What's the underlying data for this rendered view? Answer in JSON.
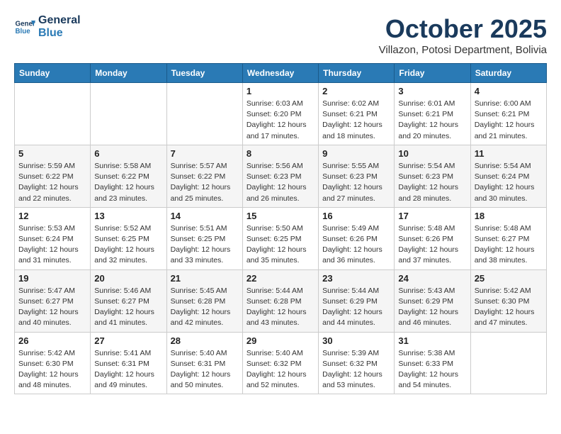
{
  "header": {
    "logo_line1": "General",
    "logo_line2": "Blue",
    "month_title": "October 2025",
    "location": "Villazon, Potosi Department, Bolivia"
  },
  "weekdays": [
    "Sunday",
    "Monday",
    "Tuesday",
    "Wednesday",
    "Thursday",
    "Friday",
    "Saturday"
  ],
  "weeks": [
    [
      {
        "day": "",
        "info": ""
      },
      {
        "day": "",
        "info": ""
      },
      {
        "day": "",
        "info": ""
      },
      {
        "day": "1",
        "info": "Sunrise: 6:03 AM\nSunset: 6:20 PM\nDaylight: 12 hours\nand 17 minutes."
      },
      {
        "day": "2",
        "info": "Sunrise: 6:02 AM\nSunset: 6:21 PM\nDaylight: 12 hours\nand 18 minutes."
      },
      {
        "day": "3",
        "info": "Sunrise: 6:01 AM\nSunset: 6:21 PM\nDaylight: 12 hours\nand 20 minutes."
      },
      {
        "day": "4",
        "info": "Sunrise: 6:00 AM\nSunset: 6:21 PM\nDaylight: 12 hours\nand 21 minutes."
      }
    ],
    [
      {
        "day": "5",
        "info": "Sunrise: 5:59 AM\nSunset: 6:22 PM\nDaylight: 12 hours\nand 22 minutes."
      },
      {
        "day": "6",
        "info": "Sunrise: 5:58 AM\nSunset: 6:22 PM\nDaylight: 12 hours\nand 23 minutes."
      },
      {
        "day": "7",
        "info": "Sunrise: 5:57 AM\nSunset: 6:22 PM\nDaylight: 12 hours\nand 25 minutes."
      },
      {
        "day": "8",
        "info": "Sunrise: 5:56 AM\nSunset: 6:23 PM\nDaylight: 12 hours\nand 26 minutes."
      },
      {
        "day": "9",
        "info": "Sunrise: 5:55 AM\nSunset: 6:23 PM\nDaylight: 12 hours\nand 27 minutes."
      },
      {
        "day": "10",
        "info": "Sunrise: 5:54 AM\nSunset: 6:23 PM\nDaylight: 12 hours\nand 28 minutes."
      },
      {
        "day": "11",
        "info": "Sunrise: 5:54 AM\nSunset: 6:24 PM\nDaylight: 12 hours\nand 30 minutes."
      }
    ],
    [
      {
        "day": "12",
        "info": "Sunrise: 5:53 AM\nSunset: 6:24 PM\nDaylight: 12 hours\nand 31 minutes."
      },
      {
        "day": "13",
        "info": "Sunrise: 5:52 AM\nSunset: 6:25 PM\nDaylight: 12 hours\nand 32 minutes."
      },
      {
        "day": "14",
        "info": "Sunrise: 5:51 AM\nSunset: 6:25 PM\nDaylight: 12 hours\nand 33 minutes."
      },
      {
        "day": "15",
        "info": "Sunrise: 5:50 AM\nSunset: 6:25 PM\nDaylight: 12 hours\nand 35 minutes."
      },
      {
        "day": "16",
        "info": "Sunrise: 5:49 AM\nSunset: 6:26 PM\nDaylight: 12 hours\nand 36 minutes."
      },
      {
        "day": "17",
        "info": "Sunrise: 5:48 AM\nSunset: 6:26 PM\nDaylight: 12 hours\nand 37 minutes."
      },
      {
        "day": "18",
        "info": "Sunrise: 5:48 AM\nSunset: 6:27 PM\nDaylight: 12 hours\nand 38 minutes."
      }
    ],
    [
      {
        "day": "19",
        "info": "Sunrise: 5:47 AM\nSunset: 6:27 PM\nDaylight: 12 hours\nand 40 minutes."
      },
      {
        "day": "20",
        "info": "Sunrise: 5:46 AM\nSunset: 6:27 PM\nDaylight: 12 hours\nand 41 minutes."
      },
      {
        "day": "21",
        "info": "Sunrise: 5:45 AM\nSunset: 6:28 PM\nDaylight: 12 hours\nand 42 minutes."
      },
      {
        "day": "22",
        "info": "Sunrise: 5:44 AM\nSunset: 6:28 PM\nDaylight: 12 hours\nand 43 minutes."
      },
      {
        "day": "23",
        "info": "Sunrise: 5:44 AM\nSunset: 6:29 PM\nDaylight: 12 hours\nand 44 minutes."
      },
      {
        "day": "24",
        "info": "Sunrise: 5:43 AM\nSunset: 6:29 PM\nDaylight: 12 hours\nand 46 minutes."
      },
      {
        "day": "25",
        "info": "Sunrise: 5:42 AM\nSunset: 6:30 PM\nDaylight: 12 hours\nand 47 minutes."
      }
    ],
    [
      {
        "day": "26",
        "info": "Sunrise: 5:42 AM\nSunset: 6:30 PM\nDaylight: 12 hours\nand 48 minutes."
      },
      {
        "day": "27",
        "info": "Sunrise: 5:41 AM\nSunset: 6:31 PM\nDaylight: 12 hours\nand 49 minutes."
      },
      {
        "day": "28",
        "info": "Sunrise: 5:40 AM\nSunset: 6:31 PM\nDaylight: 12 hours\nand 50 minutes."
      },
      {
        "day": "29",
        "info": "Sunrise: 5:40 AM\nSunset: 6:32 PM\nDaylight: 12 hours\nand 52 minutes."
      },
      {
        "day": "30",
        "info": "Sunrise: 5:39 AM\nSunset: 6:32 PM\nDaylight: 12 hours\nand 53 minutes."
      },
      {
        "day": "31",
        "info": "Sunrise: 5:38 AM\nSunset: 6:33 PM\nDaylight: 12 hours\nand 54 minutes."
      },
      {
        "day": "",
        "info": ""
      }
    ]
  ]
}
